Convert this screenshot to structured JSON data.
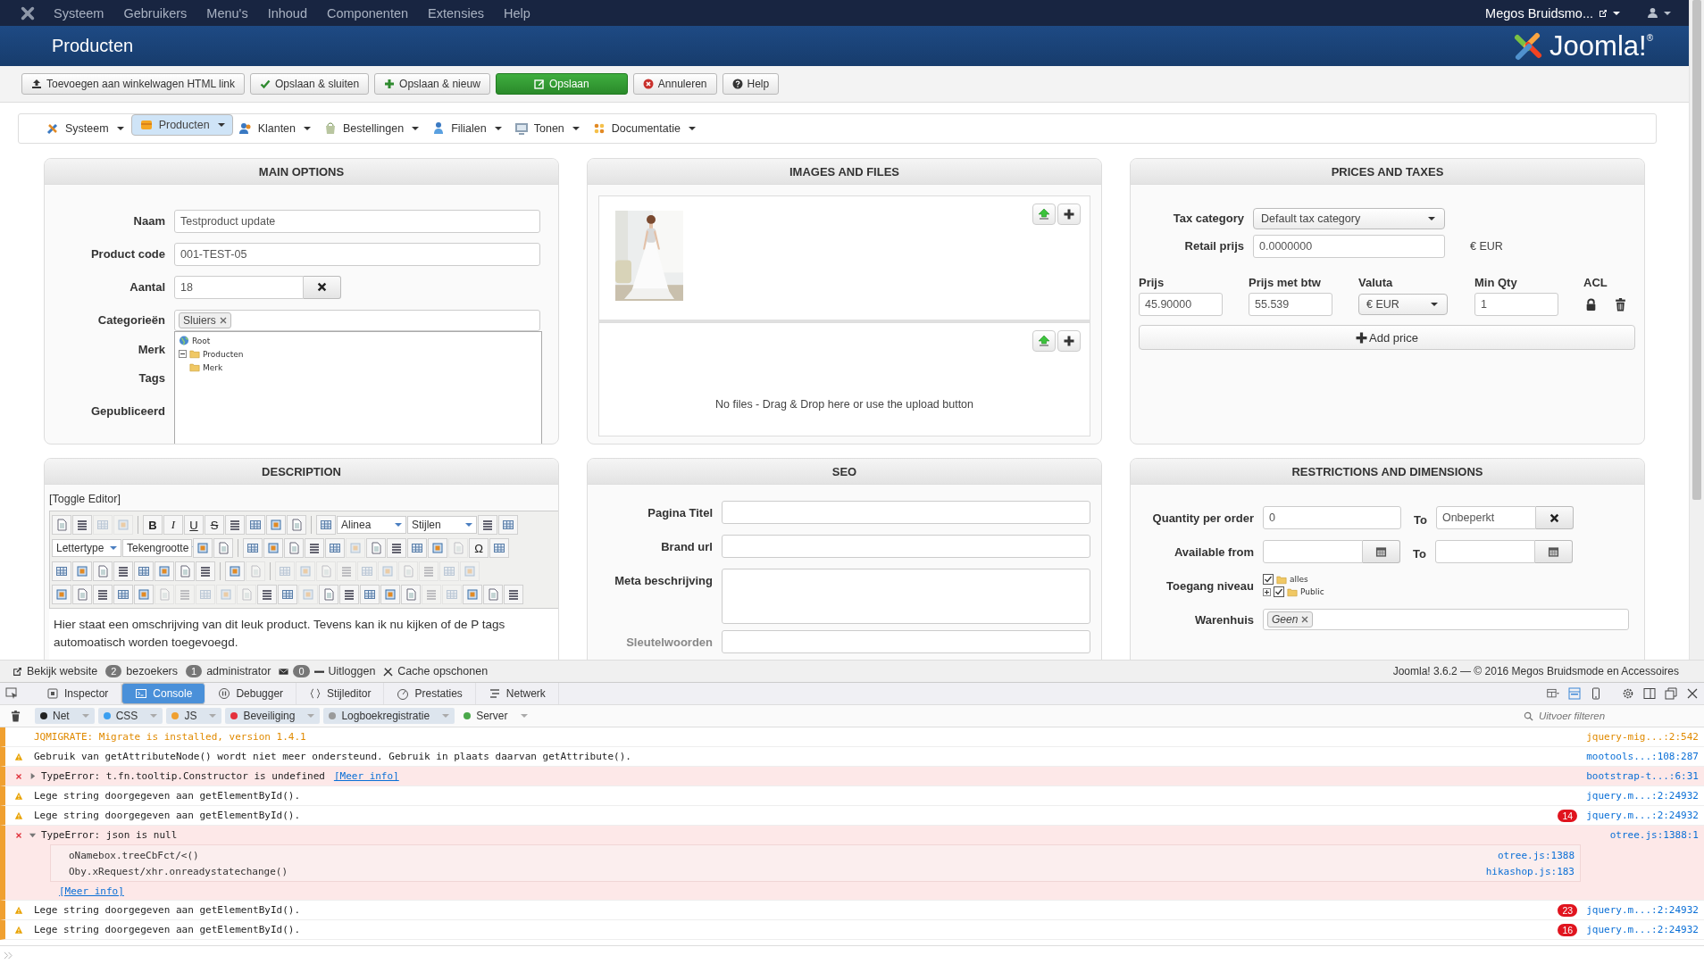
{
  "top_menu": {
    "items": [
      "Systeem",
      "Gebruikers",
      "Menu's",
      "Inhoud",
      "Componenten",
      "Extensies",
      "Help"
    ],
    "user": "Megos Bruidsmo..."
  },
  "header": {
    "title": "Producten",
    "logo_text": "Joomla!",
    "logo_mark": "®"
  },
  "toolbar": [
    {
      "kind": "upload",
      "label": "Toevoegen aan winkelwagen HTML link"
    },
    {
      "kind": "check",
      "label": "Opslaan & sluiten"
    },
    {
      "kind": "plus",
      "label": "Opslaan & nieuw"
    },
    {
      "kind": "primary",
      "label": "Opslaan"
    },
    {
      "kind": "cancel",
      "label": "Annuleren"
    },
    {
      "kind": "help",
      "label": "Help"
    }
  ],
  "submenu": [
    {
      "label": "Systeem",
      "selected": false
    },
    {
      "label": "Producten",
      "selected": true
    },
    {
      "label": "Klanten",
      "selected": false
    },
    {
      "label": "Bestellingen",
      "selected": false
    },
    {
      "label": "Filialen",
      "selected": false
    },
    {
      "label": "Tonen",
      "selected": false
    },
    {
      "label": "Documentatie",
      "selected": false
    }
  ],
  "main_options": {
    "title": "MAIN OPTIONS",
    "naam": {
      "label": "Naam",
      "value": "Testproduct update"
    },
    "code": {
      "label": "Product code",
      "value": "001-TEST-05"
    },
    "aantal": {
      "label": "Aantal",
      "value": "18"
    },
    "categories": {
      "label": "Categorieën",
      "tags": [
        "Sluiers"
      ]
    },
    "more_labels": [
      "Merk",
      "Tags",
      "Gepubliceerd"
    ],
    "tree": {
      "root": "Root",
      "items": [
        {
          "label": "Producten",
          "expanded": true
        },
        {
          "label": "Merk"
        }
      ]
    }
  },
  "images": {
    "title": "IMAGES AND FILES",
    "files_empty": "No files - Drag & Drop here or use the upload button"
  },
  "prices": {
    "title": "PRICES AND TAXES",
    "tax": {
      "label": "Tax category",
      "value": "Default tax category"
    },
    "retail": {
      "label": "Retail prijs",
      "value": "0.0000000",
      "currency": "€ EUR"
    },
    "columns": [
      "Prijs",
      "Prijs met btw",
      "Valuta",
      "Min Qty",
      "ACL"
    ],
    "rows": [
      {
        "price": "45.90000",
        "price_vat": "55.539",
        "currency": "€ EUR",
        "min_qty": "1"
      }
    ],
    "add": "Add price"
  },
  "description": {
    "title": "DESCRIPTION",
    "toggle": "[Toggle Editor]",
    "toolbar": [
      [
        {
          "kind": "tool",
          "disabled": false
        },
        {
          "kind": "tool",
          "disabled": false
        },
        {
          "kind": "tool",
          "disabled": true
        },
        {
          "kind": "tool",
          "disabled": true
        },
        {
          "kind": "sep"
        },
        {
          "kind": "bold",
          "label": "B"
        },
        {
          "kind": "italic",
          "label": "I"
        },
        {
          "kind": "underline",
          "label": "U"
        },
        {
          "kind": "strike",
          "label": "S"
        },
        {
          "kind": "tool",
          "disabled": false
        },
        {
          "kind": "tool",
          "disabled": false
        },
        {
          "kind": "tool",
          "disabled": false
        },
        {
          "kind": "tool",
          "disabled": false
        },
        {
          "kind": "sep"
        },
        {
          "kind": "tool",
          "disabled": false
        },
        {
          "kind": "select",
          "label": "Alinea"
        },
        {
          "kind": "select",
          "label": "Stijlen"
        },
        {
          "kind": "tool",
          "disabled": false
        },
        {
          "kind": "tool",
          "disabled": false
        }
      ],
      [
        {
          "kind": "select",
          "label": "Lettertype"
        },
        {
          "kind": "select",
          "label": "Tekengrootte"
        },
        {
          "kind": "tool",
          "disabled": false
        },
        {
          "kind": "tool",
          "disabled": false
        },
        {
          "kind": "sep"
        },
        {
          "kind": "tool",
          "disabled": false
        },
        {
          "kind": "tool",
          "disabled": false
        },
        {
          "kind": "tool",
          "disabled": false
        },
        {
          "kind": "tool",
          "disabled": false
        },
        {
          "kind": "tool",
          "disabled": false
        },
        {
          "kind": "tool",
          "disabled": true
        },
        {
          "kind": "tool",
          "disabled": false
        },
        {
          "kind": "tool",
          "disabled": false
        },
        {
          "kind": "tool",
          "disabled": false
        },
        {
          "kind": "tool",
          "disabled": false
        },
        {
          "kind": "tool",
          "disabled": true
        },
        {
          "kind": "glyph",
          "label": "Ω"
        },
        {
          "kind": "tool",
          "disabled": false
        }
      ],
      [
        {
          "kind": "tool",
          "disabled": false
        },
        {
          "kind": "tool",
          "disabled": false
        },
        {
          "kind": "tool",
          "disabled": false
        },
        {
          "kind": "tool",
          "disabled": false
        },
        {
          "kind": "tool",
          "disabled": false
        },
        {
          "kind": "tool",
          "disabled": false
        },
        {
          "kind": "tool",
          "disabled": false
        },
        {
          "kind": "tool",
          "disabled": false
        },
        {
          "kind": "sep"
        },
        {
          "kind": "tool",
          "disabled": false
        },
        {
          "kind": "tool",
          "disabled": true
        },
        {
          "kind": "sep"
        },
        {
          "kind": "tool",
          "disabled": true
        },
        {
          "kind": "tool",
          "disabled": true
        },
        {
          "kind": "tool",
          "disabled": true
        },
        {
          "kind": "tool",
          "disabled": true
        },
        {
          "kind": "tool",
          "disabled": true
        },
        {
          "kind": "tool",
          "disabled": true
        },
        {
          "kind": "tool",
          "disabled": true
        },
        {
          "kind": "tool",
          "disabled": true
        },
        {
          "kind": "tool",
          "disabled": true
        },
        {
          "kind": "tool",
          "disabled": true
        }
      ],
      [
        {
          "kind": "tool",
          "disabled": false
        },
        {
          "kind": "tool",
          "disabled": false
        },
        {
          "kind": "tool",
          "disabled": false
        },
        {
          "kind": "tool",
          "disabled": false
        },
        {
          "kind": "tool",
          "disabled": false
        },
        {
          "kind": "tool",
          "disabled": true
        },
        {
          "kind": "tool",
          "disabled": true
        },
        {
          "kind": "tool",
          "disabled": true
        },
        {
          "kind": "tool",
          "disabled": true
        },
        {
          "kind": "tool",
          "disabled": true
        },
        {
          "kind": "tool",
          "disabled": false
        },
        {
          "kind": "tool",
          "disabled": false
        },
        {
          "kind": "tool",
          "disabled": true
        },
        {
          "kind": "tool",
          "disabled": false
        },
        {
          "kind": "tool",
          "disabled": false
        },
        {
          "kind": "tool",
          "disabled": false
        },
        {
          "kind": "tool",
          "disabled": false
        },
        {
          "kind": "tool",
          "disabled": false
        },
        {
          "kind": "tool",
          "disabled": true
        },
        {
          "kind": "tool",
          "disabled": true
        },
        {
          "kind": "tool",
          "disabled": false
        },
        {
          "kind": "tool",
          "disabled": false
        },
        {
          "kind": "tool",
          "disabled": false
        }
      ]
    ],
    "text": "Hier staat een omschrijving van dit leuk product. Tevens kan ik nu kijken of de P tags automoatisch worden toegevoegd."
  },
  "seo": {
    "title": "SEO",
    "fields": [
      {
        "label": "Pagina Titel",
        "kind": "input"
      },
      {
        "label": "Brand url",
        "kind": "input"
      },
      {
        "label": "Meta beschrijving",
        "kind": "textarea"
      },
      {
        "label": "Sleutelwoorden",
        "kind": "input"
      }
    ]
  },
  "restrictions": {
    "title": "RESTRICTIONS AND DIMENSIONS",
    "qty": {
      "label": "Quantity per order",
      "from": "0",
      "to_label": "To",
      "to": "Onbeperkt"
    },
    "available": {
      "label": "Available from",
      "to_label": "To"
    },
    "access": {
      "label": "Toegang niveau",
      "items": [
        {
          "label": "alles",
          "checked": true
        },
        {
          "label": "Public",
          "checked": true,
          "expanded": false
        }
      ]
    },
    "warehouse": {
      "label": "Warenhuis",
      "tags": [
        "Geen"
      ]
    }
  },
  "status_bar": {
    "view_site": "Bekijk website",
    "visitors_count": "2",
    "visitors": "bezoekers",
    "admins_count": "1",
    "admins": "administrator",
    "messages_count": "0",
    "logout": "Uitloggen",
    "cache": "Cache opschonen",
    "copyright": "Joomla! 3.6.2 — © 2016 Megos Bruidsmode en Accessoires"
  },
  "devtools": {
    "tabs": [
      {
        "label": "Inspector",
        "selected": false
      },
      {
        "label": "Console",
        "selected": true
      },
      {
        "label": "Debugger",
        "selected": false
      },
      {
        "label": "Stijleditor",
        "selected": false
      },
      {
        "label": "Prestaties",
        "selected": false
      },
      {
        "label": "Netwerk",
        "selected": false
      }
    ],
    "filters": [
      {
        "label": "Net",
        "color": "#222222",
        "selected": true
      },
      {
        "label": "CSS",
        "color": "#3b9ff0",
        "selected": true
      },
      {
        "label": "JS",
        "color": "#f0a030",
        "selected": true
      },
      {
        "label": "Beveiliging",
        "color": "#e5303c",
        "selected": true
      },
      {
        "label": "Logboekregistratie",
        "color": "#9a9a9a",
        "selected": true
      },
      {
        "label": "Server",
        "color": "#4aa84a",
        "selected": false
      }
    ],
    "filter_placeholder": "Uitvoer filteren",
    "messages": [
      {
        "kind": "notice",
        "text": "JQMIGRATE: Migrate is installed, version 1.4.1",
        "source": "jquery-mig...:2:542"
      },
      {
        "kind": "warning",
        "text": "Gebruik van getAttributeNode() wordt niet meer ondersteund. Gebruik in plaats daarvan getAttribute().",
        "source": "mootools...:108:287"
      },
      {
        "kind": "error",
        "expanded": false,
        "text": "TypeError: t.fn.tooltip.Constructor is undefined",
        "link": "[Meer info]",
        "source": "bootstrap-t...:6:31"
      },
      {
        "kind": "warning",
        "text": "Lege string doorgegeven aan getElementById().",
        "source": "jquery.m...:2:24932"
      },
      {
        "kind": "warning",
        "text": "Lege string doorgegeven aan getElementById().",
        "count": "14",
        "source": "jquery.m...:2:24932"
      },
      {
        "kind": "error",
        "expanded": true,
        "text": "TypeError: json is null",
        "source": "otree.js:1388:1",
        "link": "[Meer info]",
        "stack": [
          {
            "function": "oNamebox.treeCbFct/<()",
            "source": "otree.js:1388"
          },
          {
            "function": "Oby.xRequest/xhr.onreadystatechange()",
            "source": "hikashop.js:183"
          }
        ]
      },
      {
        "kind": "warning",
        "text": "Lege string doorgegeven aan getElementById().",
        "count": "23",
        "source": "jquery.m...:2:24932"
      },
      {
        "kind": "warning",
        "text": "Lege string doorgegeven aan getElementById().",
        "count": "16",
        "source": "jquery.m...:2:24932"
      }
    ]
  }
}
